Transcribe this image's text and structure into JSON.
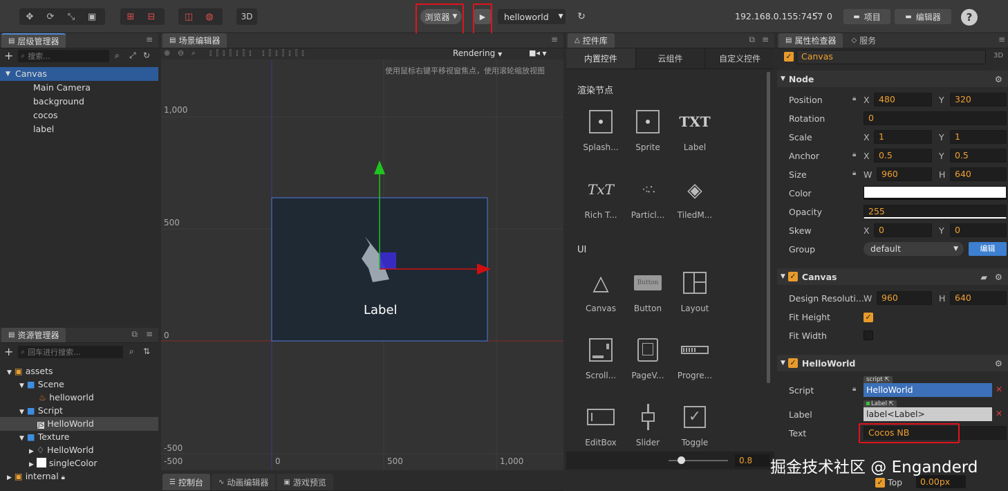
{
  "toolbar": {
    "platform_label": "浏览器",
    "scene_select": "helloworld",
    "ip_address": "192.168.0.155:7457",
    "wifi_count": "0",
    "project_button": "项目",
    "editor_button": "编辑器",
    "help": "?",
    "mode_3d": "3D"
  },
  "hierarchy": {
    "tab_label": "层级管理器",
    "search_placeholder": "搜索...",
    "items": [
      "Canvas",
      "Main Camera",
      "background",
      "cocos",
      "label"
    ]
  },
  "assets": {
    "tab_label": "资源管理器",
    "search_placeholder": "回车进行搜索...",
    "items": [
      "assets",
      "Scene",
      "helloworld",
      "Script",
      "HelloWorld",
      "Texture",
      "HelloWorld",
      "singleColor",
      "internal"
    ]
  },
  "scene": {
    "tab_label": "场景编辑器",
    "rendering_label": "Rendering",
    "hint": "使用鼠标右键平移视窗焦点，使用滚轮缩放视图",
    "y_ticks": [
      "1,000",
      "500",
      "0",
      "-500"
    ],
    "x_ticks": [
      "-500",
      "0",
      "500",
      "1,000"
    ],
    "label_text": "Label"
  },
  "bottom_tabs": [
    "控制台",
    "动画编辑器",
    "游戏预览"
  ],
  "widgets": {
    "tab_label": "控件库",
    "subtabs": [
      "内置控件",
      "云组件",
      "自定义控件"
    ],
    "section_render": "渲染节点",
    "section_ui": "UI",
    "render_items": [
      "Splash...",
      "Sprite",
      "Label",
      "Rich T...",
      "Particl...",
      "TiledM..."
    ],
    "ui_items": [
      "Canvas",
      "Button",
      "Layout",
      "Scroll...",
      "PageV...",
      "Progre...",
      "EditBox",
      "Slider",
      "Toggle"
    ],
    "zoom_value": "0.8",
    "txt_glyph": "TXT",
    "rich_glyph": "TxT",
    "button_glyph": "Button"
  },
  "inspector": {
    "tab_label": "属性检查器",
    "tab_service": "服务",
    "node_name": "Canvas",
    "mode": "3D",
    "node_section": "Node",
    "position_label": "Position",
    "position_x": "480",
    "position_y": "320",
    "rotation_label": "Rotation",
    "rotation": "0",
    "scale_label": "Scale",
    "scale_x": "1",
    "scale_y": "1",
    "anchor_label": "Anchor",
    "anchor_x": "0.5",
    "anchor_y": "0.5",
    "size_label": "Size",
    "size_w": "960",
    "size_h": "640",
    "color_label": "Color",
    "color_value": "#ffffff",
    "opacity_label": "Opacity",
    "opacity": "255",
    "skew_label": "Skew",
    "skew_x": "0",
    "skew_y": "0",
    "group_label": "Group",
    "group": "default",
    "group_edit": "编辑",
    "canvas_section": "Canvas",
    "design_res_label": "Design Resoluti...",
    "design_w": "960",
    "design_h": "640",
    "fit_height_label": "Fit Height",
    "fit_width_label": "Fit Width",
    "helloworld_section": "HelloWorld",
    "script_label": "Script",
    "script_tag": "script",
    "script_value": "HelloWorld",
    "label_label": "Label",
    "label_tag": "Label",
    "label_value": "label<Label>",
    "text_label": "Text",
    "text_value": "Cocos NB",
    "top_label": "Top",
    "top_value": "0.00px",
    "x": "X",
    "y": "Y",
    "w": "W",
    "h": "H"
  },
  "watermark": "掘金技术社区 @ Enganderd",
  "colors": {
    "accent": "#4d8ad6",
    "orange": "#f0a030",
    "highlight": "#e0141e"
  }
}
